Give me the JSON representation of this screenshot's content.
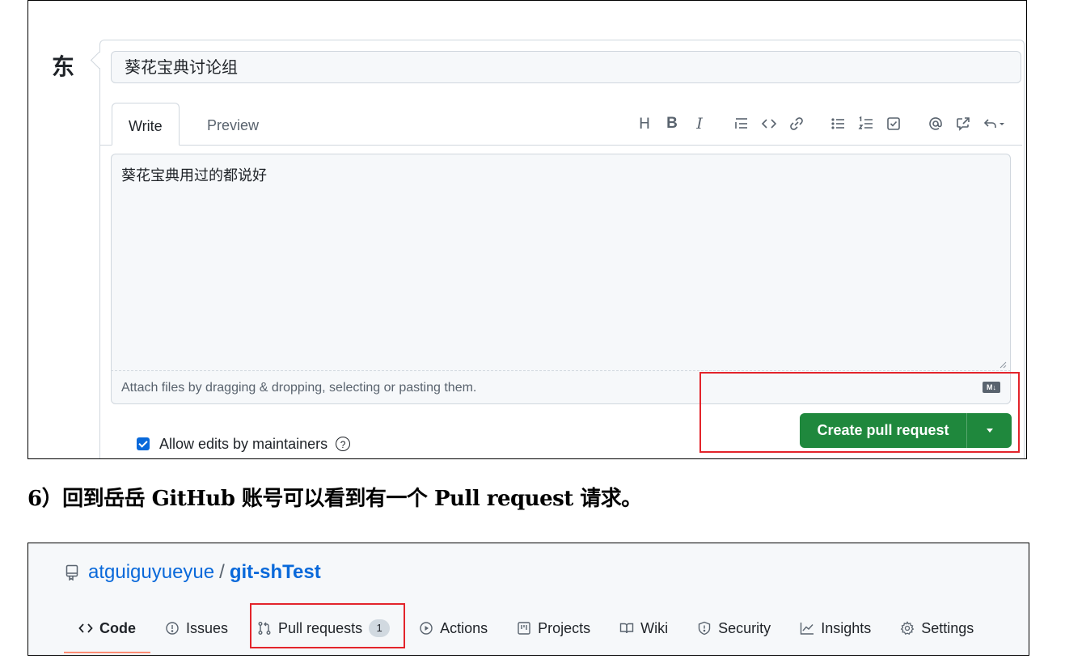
{
  "top_screenshot": {
    "avatar_char": "东",
    "title_value": "葵花宝典讨论组",
    "tabs": {
      "write": "Write",
      "preview": "Preview"
    },
    "toolbar_icons": [
      "heading-icon",
      "bold-icon",
      "italic-icon",
      "quote-icon",
      "code-icon",
      "link-icon",
      "unordered-list-icon",
      "ordered-list-icon",
      "task-list-icon",
      "mention-icon",
      "reference-icon",
      "reply-icon"
    ],
    "toolbar_glyphs": {
      "heading": "H",
      "bold": "B",
      "italic": "I"
    },
    "body_value": "葵花宝典用过的都说好",
    "attach_text": "Attach files by dragging & dropping, selecting or pasting them.",
    "markdown_badge": "M↓",
    "allow_edits_label": "Allow edits by maintainers",
    "allow_edits_checked": true,
    "create_button_label": "Create pull request",
    "accent_green": "#1f883d",
    "highlight_red": "#e3242b"
  },
  "caption": "6）回到岳岳 GitHub 账号可以看到有一个 Pull request 请求。",
  "bottom_screenshot": {
    "repo_owner": "atguiguyueyue",
    "repo_separator": "/",
    "repo_name": "git-shTest",
    "nav": {
      "code": "Code",
      "issues": "Issues",
      "pull_requests": "Pull requests",
      "pull_requests_count": "1",
      "actions": "Actions",
      "projects": "Projects",
      "wiki": "Wiki",
      "security": "Security",
      "insights": "Insights",
      "settings": "Settings"
    }
  }
}
